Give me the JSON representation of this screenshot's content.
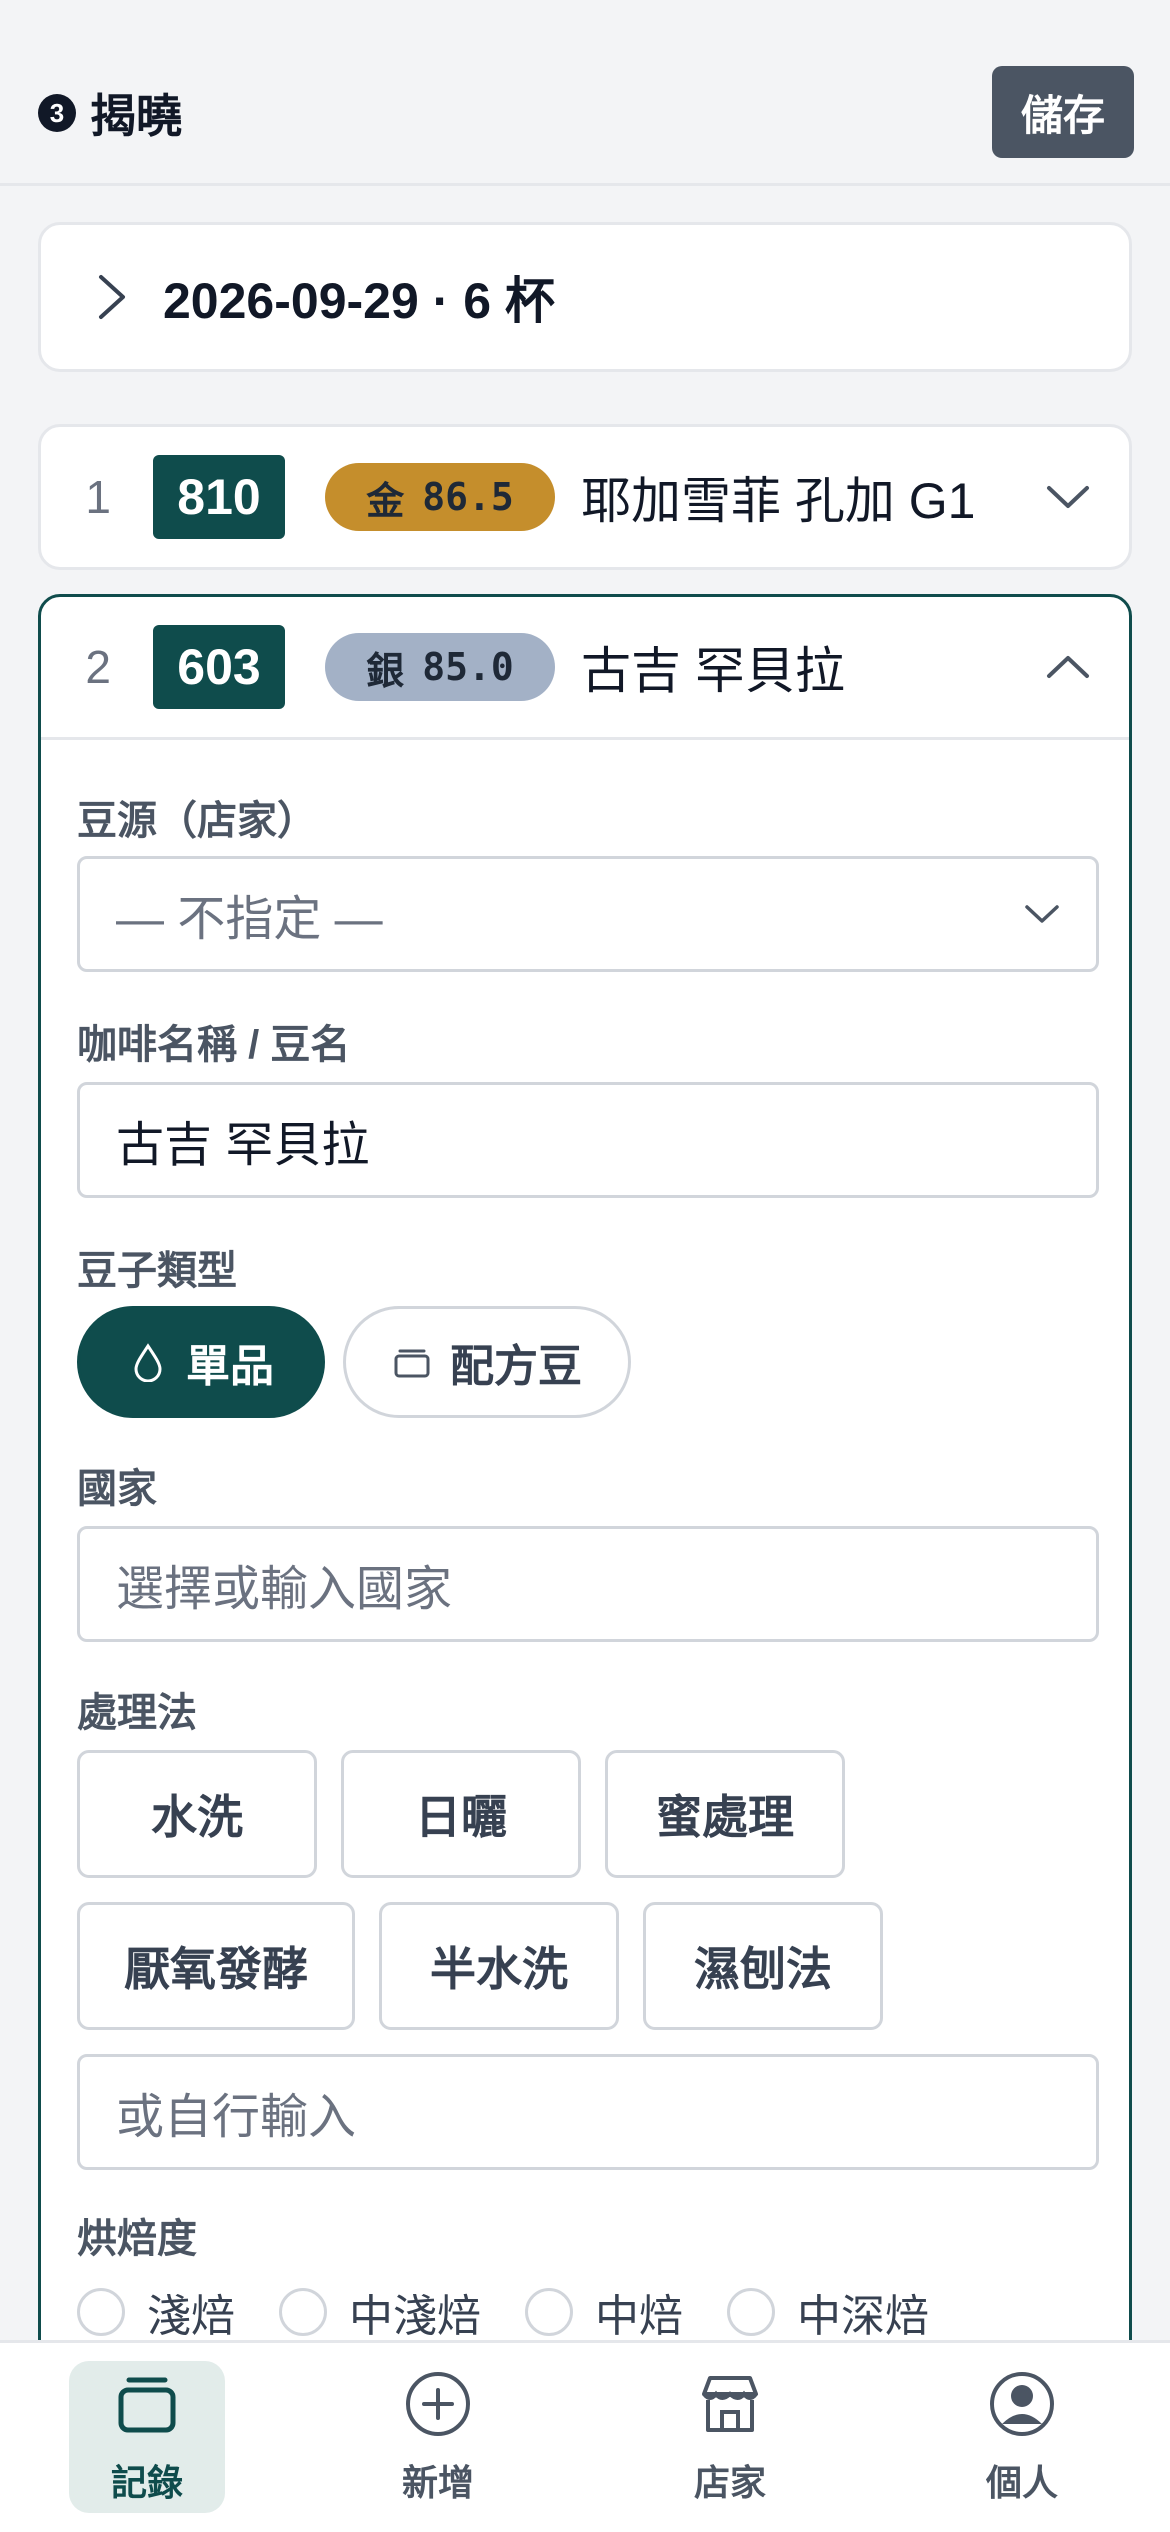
{
  "header": {
    "step_number": "3",
    "title": "揭曉",
    "save_label": "儲存"
  },
  "session": {
    "label": "2026-09-29 · 6 杯"
  },
  "cups": [
    {
      "index": "1",
      "code": "810",
      "medal": "金",
      "score": "86.5",
      "name": "耶加雪菲 孔加 G1",
      "expanded": false
    },
    {
      "index": "2",
      "code": "603",
      "medal": "銀",
      "score": "85.0",
      "name": "古吉 罕貝拉",
      "expanded": true
    }
  ],
  "form": {
    "source_label": "豆源（店家）",
    "source_value": "— 不指定 —",
    "coffee_name_label": "咖啡名稱 / 豆名",
    "coffee_name_value": "古吉 罕貝拉",
    "bean_type_label": "豆子類型",
    "bean_types": [
      "單品",
      "配方豆"
    ],
    "bean_type_selected": "單品",
    "country_label": "國家",
    "country_placeholder": "選擇或輸入國家",
    "process_label": "處理法",
    "processes": [
      "水洗",
      "日曬",
      "蜜處理",
      "厭氧發酵",
      "半水洗",
      "濕刨法"
    ],
    "process_placeholder": "或自行輸入",
    "roast_label": "烘焙度",
    "roast_levels": [
      "淺焙",
      "中淺焙",
      "中焙",
      "中深焙"
    ]
  },
  "nav": {
    "items": [
      "記錄",
      "新增",
      "店家",
      "個人"
    ],
    "active": "記錄"
  },
  "colors": {
    "primary": "#0f4c4c",
    "gold": "#c58e2c",
    "silver": "#a3b1c6"
  }
}
